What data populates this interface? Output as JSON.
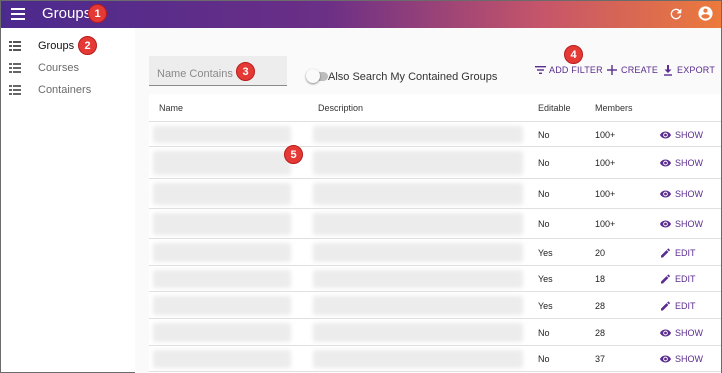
{
  "appbar": {
    "title": "Groups",
    "accent_from": "#4b2a8e",
    "accent_to": "#ec7a3c"
  },
  "badges": [
    "1",
    "2",
    "3",
    "4",
    "5"
  ],
  "sidebar": {
    "items": [
      {
        "label": "Groups",
        "icon": "list-icon",
        "active": true
      },
      {
        "label": "Courses",
        "icon": "list-icon",
        "active": false
      },
      {
        "label": "Containers",
        "icon": "list-icon",
        "active": false
      }
    ]
  },
  "filter": {
    "placeholder": "Name Contains",
    "value": ""
  },
  "toggle": {
    "label": "Also Search My Contained Groups",
    "checked": false
  },
  "toolbar": {
    "add_filter": "ADD FILTER",
    "create": "CREATE",
    "export": "EXPORT"
  },
  "table": {
    "headers": [
      "Name",
      "Description",
      "Editable",
      "Members"
    ],
    "rows": [
      {
        "editable": "No",
        "members": "100+",
        "action": "SHOW"
      },
      {
        "editable": "No",
        "members": "100+",
        "action": "SHOW"
      },
      {
        "editable": "No",
        "members": "100+",
        "action": "SHOW"
      },
      {
        "editable": "No",
        "members": "100+",
        "action": "SHOW"
      },
      {
        "editable": "Yes",
        "members": "20",
        "action": "EDIT"
      },
      {
        "editable": "Yes",
        "members": "18",
        "action": "EDIT"
      },
      {
        "editable": "Yes",
        "members": "28",
        "action": "EDIT"
      },
      {
        "editable": "No",
        "members": "28",
        "action": "SHOW"
      },
      {
        "editable": "No",
        "members": "37",
        "action": "SHOW"
      }
    ]
  }
}
